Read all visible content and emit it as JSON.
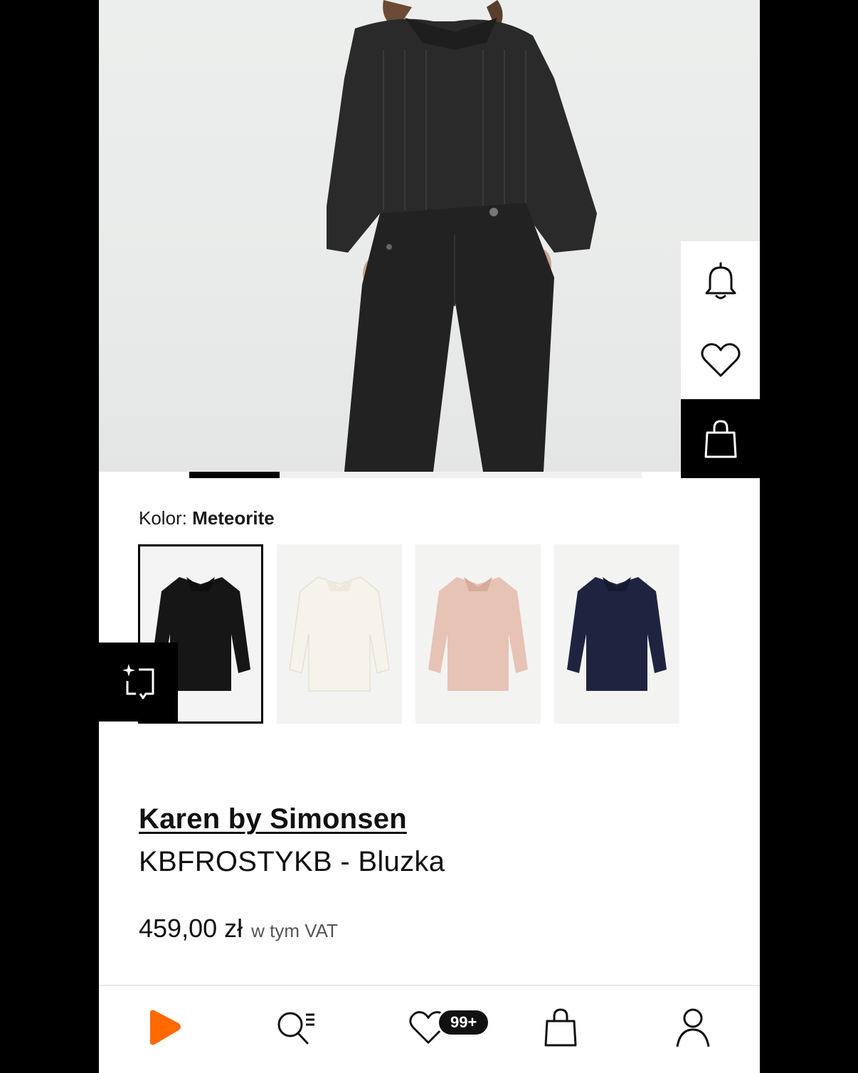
{
  "product": {
    "color_label": "Kolor:",
    "color_value": "Meteorite",
    "brand": "Karen by Simonsen",
    "name": "KBFROSTYKB - Bluzka",
    "price": "459,00 zł",
    "vat_note": "w tym VAT"
  },
  "gallery": {
    "total_images": 5,
    "active_index": 0
  },
  "color_swatches": [
    {
      "name": "Meteorite",
      "tint": "#161616",
      "selected": true
    },
    {
      "name": "white",
      "tint": "#f6f3ea",
      "selected": false
    },
    {
      "name": "rose",
      "tint": "#e6c3b5",
      "selected": false
    },
    {
      "name": "navy",
      "tint": "#1e2440",
      "selected": false
    }
  ],
  "actions": {
    "icons": [
      "bell-icon",
      "heart-icon",
      "shopping-bag-icon"
    ]
  },
  "bottom_nav": {
    "items": [
      "home-logo-icon",
      "search-icon",
      "wishlist-icon",
      "bag-icon",
      "account-icon"
    ],
    "wishlist_badge": "99+"
  },
  "colors": {
    "brand_orange": "#ff6900",
    "dark": "#000000"
  }
}
